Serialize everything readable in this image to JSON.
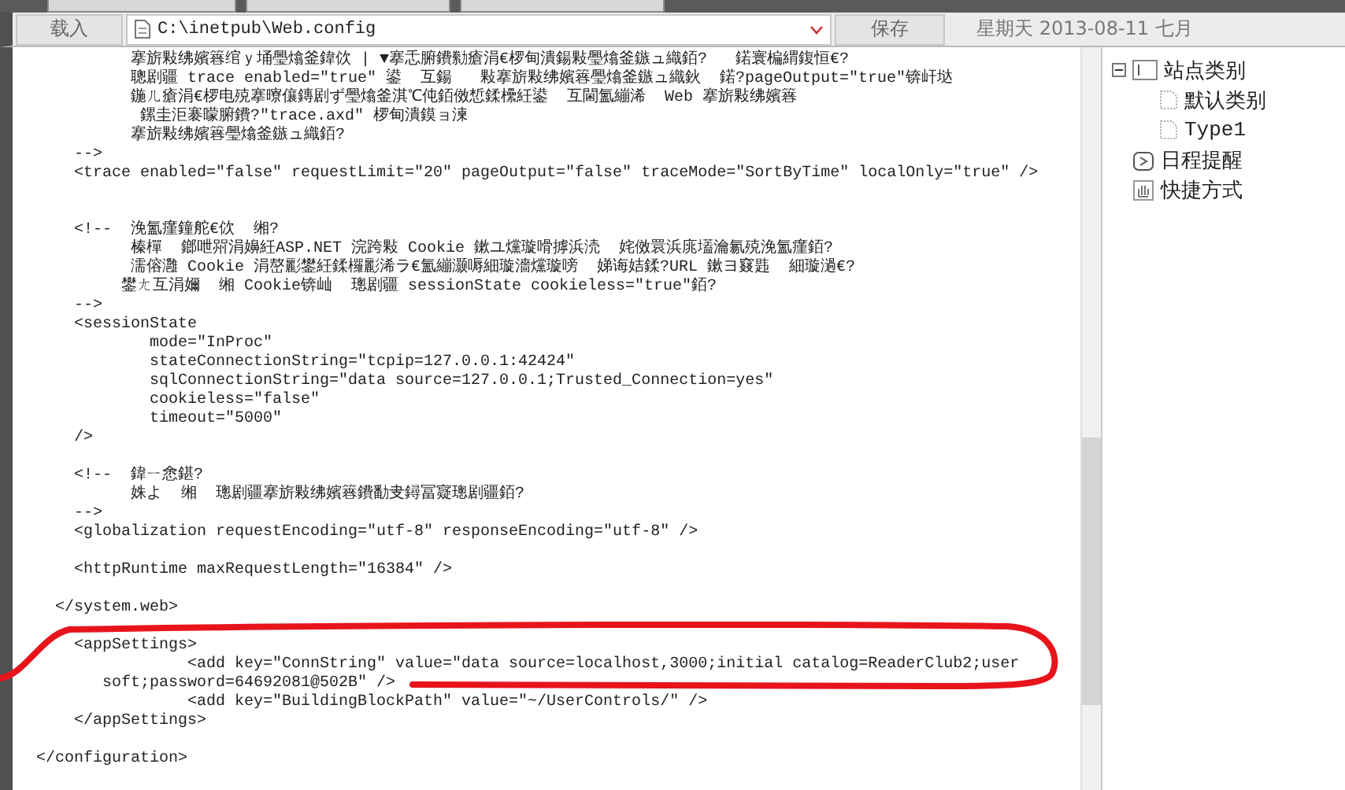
{
  "toolbar": {
    "load_button": "载入",
    "path": "C:\\inetpub\\Web.config",
    "save_button": "保存",
    "date": "星期天 2013-08-11 七月"
  },
  "code_lines": [
    {
      "kind": "text",
      "text": "          搴旂敤绋嬪簭绾ｙ埇璺熻釜鍏佽 | ▼搴忎腑鐨勬瘡涓€椤甸潰鍚敤璺熻釜鏃ュ織銆?   鍩寰楄緭鍑恒€?"
    },
    {
      "kind": "text",
      "text": "          聰剧疆 trace enabled=\"true\" 鍙  互鍚   敤搴旂敤绋嬪簭璺熻釜鏃ュ織鈥  鍩?pageOutput=\"true\"锛屽垯"
    },
    {
      "kind": "text",
      "text": "          鍦ㄦ瘡涓€椤电殑搴曢儴鏄剧ず璺熻釜淇℃伅銆傚惁鍒欙紝鍙  互閫氳繃浠  Web 搴旂敤绋嬪簭"
    },
    {
      "kind": "text",
      "text": "           鏍圭洰褰曚腑鐨?\"trace.axd\" 椤甸潰鏌ョ湅"
    },
    {
      "kind": "text",
      "text": "          搴旂敤绋嬪簭璺熻釜鏃ュ織銆?"
    },
    {
      "kind": "text",
      "text": "    -->"
    },
    {
      "kind": "text",
      "text": "    <trace enabled=\"false\" requestLimit=\"20\" pageOutput=\"false\" traceMode=\"SortByTime\" localOnly=\"true\" />"
    },
    {
      "kind": "blank"
    },
    {
      "kind": "blank"
    },
    {
      "kind": "text",
      "text": "    <!--  浼氳瘽鐘舵€佽  缃?"
    },
    {
      "kind": "text",
      "text": "          榛樿  鎯呭喌涓嬶紝ASP.NET 浣跨敤 Cookie 鏉ユ爣璇嗗摢浜涜  姹傚睘浜庣壒瀹氱殑浼氳瘽銆?"
    },
    {
      "kind": "text",
      "text": "          濡傛灉 Cookie 涓嶅彲鐢紝鍒欏彲浠ラ€氳繃灏嗕細璇濇爣璇嗙  娣诲姞鍒?URL 鏉ヨ窡韪  細璇濄€?"
    },
    {
      "kind": "text",
      "text": "         鐢ㄤ互涓嬭  缃 Cookie锛屾  璁剧疆 sessionState cookieless=\"true\"銆?"
    },
    {
      "kind": "text",
      "text": "    -->"
    },
    {
      "kind": "text",
      "text": "    <sessionState"
    },
    {
      "kind": "text",
      "text": "            mode=\"InProc\""
    },
    {
      "kind": "text",
      "text": "            stateConnectionString=\"tcpip=127.0.0.1:42424\""
    },
    {
      "kind": "text",
      "text": "            sqlConnectionString=\"data source=127.0.0.1;Trusted_Connection=yes\""
    },
    {
      "kind": "text",
      "text": "            cookieless=\"false\""
    },
    {
      "kind": "text",
      "text": "            timeout=\"5000\""
    },
    {
      "kind": "text",
      "text": "    />"
    },
    {
      "kind": "blank"
    },
    {
      "kind": "text",
      "text": "    <!--  鍏ㄧ悆鍖?"
    },
    {
      "kind": "text",
      "text": "          姝よ  缃  璁剧疆搴旂敤绋嬪簭鐨勫叏鐞冨寲璁剧疆銆?"
    },
    {
      "kind": "text",
      "text": "    -->"
    },
    {
      "kind": "text",
      "text": "    <globalization requestEncoding=\"utf-8\" responseEncoding=\"utf-8\" />"
    },
    {
      "kind": "blank"
    },
    {
      "kind": "text",
      "text": "    <httpRuntime maxRequestLength=\"16384\" />"
    },
    {
      "kind": "blank"
    },
    {
      "kind": "text",
      "text": "  </system.web>"
    },
    {
      "kind": "blank"
    },
    {
      "kind": "text",
      "text": "    <appSettings>"
    },
    {
      "kind": "text",
      "text": "                <add key=\"ConnString\" value=\"data source=localhost,3000;initial catalog=ReaderClub2;user"
    },
    {
      "kind": "text",
      "text": "       soft;password=64692081@502B\" />"
    },
    {
      "kind": "text",
      "text": "                <add key=\"BuildingBlockPath\" value=\"~/UserControls/\" />"
    },
    {
      "kind": "text",
      "text": "    </appSettings>"
    },
    {
      "kind": "blank"
    },
    {
      "kind": "text",
      "text": "</configuration>"
    }
  ],
  "tree": [
    {
      "label": "站点类别",
      "kind": "category",
      "expanded": true,
      "children": [
        {
          "label": "默认类别"
        },
        {
          "label": "Type1"
        }
      ]
    },
    {
      "label": "日程提醒",
      "kind": "schedule"
    },
    {
      "label": "快捷方式",
      "kind": "shortcut"
    }
  ]
}
